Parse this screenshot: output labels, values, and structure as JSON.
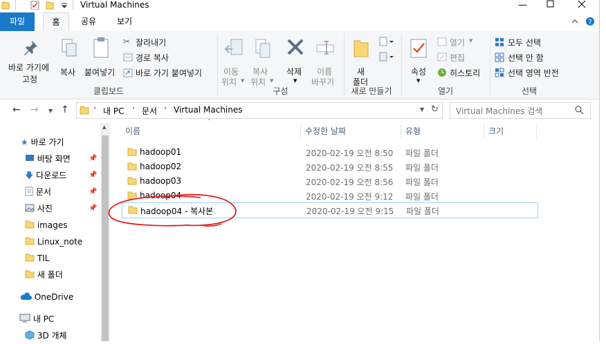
{
  "window": {
    "title": "Virtual Machines",
    "controls": [
      "minimize",
      "maximize",
      "close"
    ]
  },
  "tabs": [
    {
      "label": "파일",
      "active": false
    },
    {
      "label": "홈",
      "active": true
    },
    {
      "label": "공유",
      "active": false
    },
    {
      "label": "보기",
      "active": false
    }
  ],
  "ribbon": {
    "clipboard": {
      "pin_label_1": "바로 가기에",
      "pin_label_2": "고정",
      "copy": "복사",
      "paste": "붙여넣기",
      "cut": "잘라내기",
      "copy_path": "경로 복사",
      "paste_shortcut": "바로 가기 붙여넣기",
      "group": "클립보드"
    },
    "organize": {
      "move_1": "이동",
      "move_2": "위치",
      "copy_1": "복사",
      "copy_2": "위치",
      "delete": "삭제",
      "rename_1": "이름",
      "rename_2": "바꾸기",
      "group": "구성"
    },
    "new": {
      "new_folder_1": "새",
      "new_folder_2": "폴더",
      "group": "새로 만들기"
    },
    "open": {
      "properties": "속성",
      "open": "열기",
      "edit": "편집",
      "history": "히스토리",
      "group": "열기"
    },
    "select": {
      "select_all": "모두 선택",
      "select_none": "선택 안 함",
      "invert": "선택 영역 반전",
      "group": "선택"
    }
  },
  "address": {
    "crumbs": [
      "내 PC",
      "문서",
      "Virtual Machines"
    ],
    "search_placeholder": "Virtual Machines 검색"
  },
  "nav": {
    "quick_access": "바로 가기",
    "items": [
      {
        "label": "바탕 화면",
        "pinned": true
      },
      {
        "label": "다운로드",
        "pinned": true
      },
      {
        "label": "문서",
        "pinned": true
      },
      {
        "label": "사진",
        "pinned": true
      },
      {
        "label": "images",
        "pinned": false
      },
      {
        "label": "Linux_note",
        "pinned": false
      },
      {
        "label": "TIL",
        "pinned": false
      },
      {
        "label": "새 폴더",
        "pinned": false
      }
    ],
    "onedrive": "OneDrive",
    "this_pc": "내 PC",
    "objects_3d": "3D 개체"
  },
  "columns": {
    "name": "이름",
    "modified": "수정한 날짜",
    "type": "유형",
    "size": "크기"
  },
  "files": [
    {
      "name": "hadoop01",
      "modified": "2020-02-19 오전 8:50",
      "type": "파일 폴더"
    },
    {
      "name": "hadoop02",
      "modified": "2020-02-19 오전 8:55",
      "type": "파일 폴더"
    },
    {
      "name": "hadoop03",
      "modified": "2020-02-19 오전 8:56",
      "type": "파일 폴더"
    },
    {
      "name": "hadoop04",
      "modified": "2020-02-19 오전 9:12",
      "type": "파일 폴더"
    },
    {
      "name": "hadoop04 - 복사본",
      "modified": "2020-02-19 오전 9:15",
      "type": "파일 폴더",
      "selected": true
    }
  ],
  "colors": {
    "file_tab": "#1979ca",
    "folder": "#f8d775",
    "selection_border": "#99d1ff",
    "annotation": "#e02020"
  }
}
